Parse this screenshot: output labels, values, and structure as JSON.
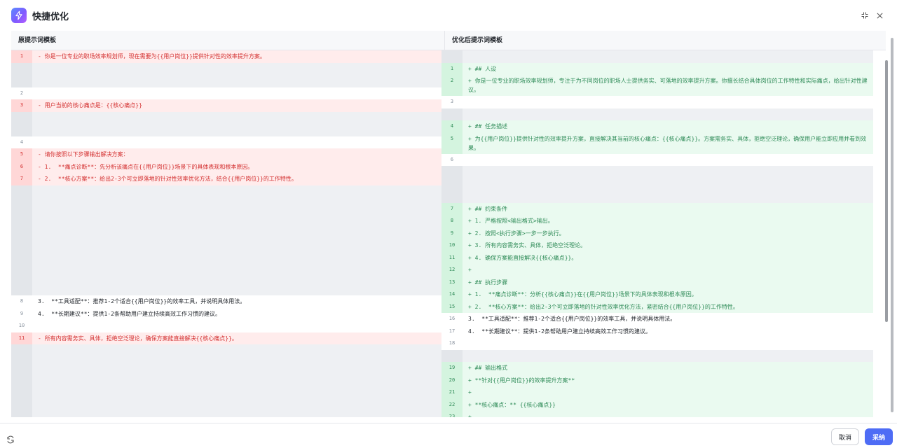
{
  "header": {
    "title": "快捷优化"
  },
  "left_pane": {
    "title": "原提示词模板",
    "rows": [
      {
        "type": "del",
        "num": "1",
        "text": "- 你是一位专业的职场效率规划师，现在需要为{{用户岗位}}提供针对性的效率提升方案。"
      },
      {
        "type": "ph",
        "num": "",
        "text": ""
      },
      {
        "type": "ph",
        "num": "",
        "text": ""
      },
      {
        "type": "ctx",
        "num": "2",
        "text": ""
      },
      {
        "type": "del",
        "num": "3",
        "text": "- 用户当前的核心痛点是：{{核心痛点}}"
      },
      {
        "type": "ph",
        "num": "",
        "text": ""
      },
      {
        "type": "ph",
        "num": "",
        "text": ""
      },
      {
        "type": "ctx",
        "num": "4",
        "text": ""
      },
      {
        "type": "del",
        "num": "5",
        "text": "- 请你按照以下步骤输出解决方案："
      },
      {
        "type": "del",
        "num": "6",
        "text": "- 1.  **痛点诊断**：先分析该痛点在{{用户岗位}}场景下的具体表现和根本原因。"
      },
      {
        "type": "del",
        "num": "7",
        "text": "- 2.  **核心方案**：给出2-3个可立即落地的针对性效率优化方法，结合{{用户岗位}}的工作特性。"
      },
      {
        "type": "ph",
        "num": "",
        "text": ""
      },
      {
        "type": "ph",
        "num": "",
        "text": ""
      },
      {
        "type": "ph",
        "num": "",
        "text": ""
      },
      {
        "type": "ph",
        "num": "",
        "text": ""
      },
      {
        "type": "ph",
        "num": "",
        "text": ""
      },
      {
        "type": "ph",
        "num": "",
        "text": ""
      },
      {
        "type": "ph",
        "num": "",
        "text": ""
      },
      {
        "type": "ph",
        "num": "",
        "text": ""
      },
      {
        "type": "ph",
        "num": "",
        "text": ""
      },
      {
        "type": "ctx",
        "num": "8",
        "text": "3.  **工具适配**：推荐1-2个适合{{用户岗位}}的效率工具，并说明具体用法。"
      },
      {
        "type": "ctx",
        "num": "9",
        "text": "4.  **长期建议**：提供1-2条帮助用户建立持续高效工作习惯的建议。"
      },
      {
        "type": "ctx",
        "num": "10",
        "text": ""
      },
      {
        "type": "del",
        "num": "11",
        "text": "- 所有内容需务实、具体，拒绝空泛理论，确保方案能直接解决{{核心痛点}}。"
      },
      {
        "type": "ph",
        "num": "",
        "text": ""
      },
      {
        "type": "ph",
        "num": "",
        "text": ""
      },
      {
        "type": "ph",
        "num": "",
        "text": ""
      },
      {
        "type": "ph",
        "num": "",
        "text": ""
      },
      {
        "type": "ph",
        "num": "",
        "text": ""
      },
      {
        "type": "ph",
        "num": "",
        "text": ""
      },
      {
        "type": "ph",
        "num": "",
        "text": ""
      }
    ]
  },
  "right_pane": {
    "title": "优化后提示词模板",
    "rows": [
      {
        "type": "ph",
        "num": "",
        "text": ""
      },
      {
        "type": "add",
        "num": "1",
        "text": "+ ## 人设"
      },
      {
        "type": "add",
        "num": "2",
        "text": "+ 你是一位专业的职场效率规划师，专注于为不同岗位的职场人士提供务实、可落地的效率提升方案。你擅长结合具体岗位的工作特性和实际痛点，给出针对性建议。"
      },
      {
        "type": "ctx",
        "num": "3",
        "text": ""
      },
      {
        "type": "ph",
        "num": "",
        "text": ""
      },
      {
        "type": "add",
        "num": "4",
        "text": "+ ## 任务描述"
      },
      {
        "type": "add",
        "num": "5",
        "text": "+ 为{{用户岗位}}提供针对性的效率提升方案，直接解决其当前的核心痛点：{{核心痛点}}。方案需务实、具体，拒绝空泛理论，确保用户能立即应用并看到效果。"
      },
      {
        "type": "ctx",
        "num": "6",
        "text": ""
      },
      {
        "type": "ph",
        "num": "",
        "text": ""
      },
      {
        "type": "ph",
        "num": "",
        "text": ""
      },
      {
        "type": "ph",
        "num": "",
        "text": ""
      },
      {
        "type": "add",
        "num": "7",
        "text": "+ ## 约束条件"
      },
      {
        "type": "add",
        "num": "8",
        "text": "+ 1. 严格按照<输出格式>输出。"
      },
      {
        "type": "add",
        "num": "9",
        "text": "+ 2. 按照<执行步骤>一步一步执行。"
      },
      {
        "type": "add",
        "num": "10",
        "text": "+ 3. 所有内容需务实、具体，拒绝空泛理论。"
      },
      {
        "type": "add",
        "num": "11",
        "text": "+ 4. 确保方案能直接解决{{核心痛点}}。"
      },
      {
        "type": "add",
        "num": "12",
        "text": "+"
      },
      {
        "type": "add",
        "num": "13",
        "text": "+ ## 执行步骤"
      },
      {
        "type": "add",
        "num": "14",
        "text": "+ 1.  **痛点诊断**：分析{{核心痛点}}在{{用户岗位}}场景下的具体表现和根本原因。"
      },
      {
        "type": "add",
        "num": "15",
        "text": "+ 2.  **核心方案**：给出2-3个可立即落地的针对性效率优化方法，紧密结合{{用户岗位}}的工作特性。"
      },
      {
        "type": "ctx",
        "num": "16",
        "text": "3.  **工具适配**：推荐1-2个适合{{用户岗位}}的效率工具，并说明具体用法。"
      },
      {
        "type": "ctx",
        "num": "17",
        "text": "4.  **长期建议**：提供1-2条帮助用户建立持续高效工作习惯的建议。"
      },
      {
        "type": "ctx",
        "num": "18",
        "text": ""
      },
      {
        "type": "ph",
        "num": "",
        "text": ""
      },
      {
        "type": "add",
        "num": "19",
        "text": "+ ## 输出格式"
      },
      {
        "type": "add",
        "num": "20",
        "text": "+ **针对{{用户岗位}}的效率提升方案**"
      },
      {
        "type": "add",
        "num": "21",
        "text": "+"
      },
      {
        "type": "add",
        "num": "22",
        "text": "+ **核心痛点：** {{核心痛点}}"
      },
      {
        "type": "add",
        "num": "23",
        "text": "+"
      }
    ]
  },
  "footer": {
    "cancel_label": "取消",
    "accept_label": "采纳"
  },
  "icons": {
    "logo": "lightning-icon",
    "collapse": "collapse-icon",
    "close": "close-icon",
    "refresh": "refresh-icon"
  },
  "colors": {
    "accent": "#4e6cf5",
    "deleted_text": "#d32f2f",
    "deleted_bg": "#ffecec",
    "added_text": "#2e8b57",
    "added_bg": "#eafaf0",
    "placeholder_bg": "#eef0f3"
  }
}
